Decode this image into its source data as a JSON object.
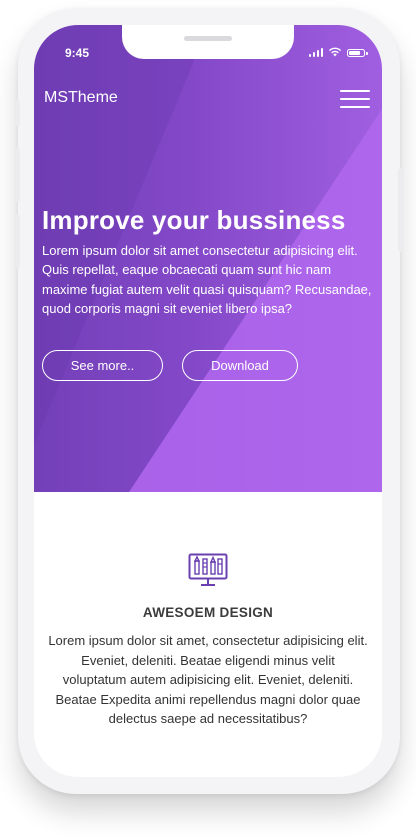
{
  "status_bar": {
    "time": "9:45"
  },
  "header": {
    "brand": "MSTheme",
    "menu_icon": "hamburger-menu-icon"
  },
  "hero": {
    "title": "Improve your bussiness",
    "text": "Lorem ipsum dolor sit amet consectetur adipisicing elit. Quis repellat, eaque obcaecati quam sunt hic nam maxime fugiat autem velit quasi quisquam? Recusandae, quod corporis magni sit eveniet libero ipsa?",
    "buttons": [
      {
        "label": "See more.."
      },
      {
        "label": "Download"
      }
    ]
  },
  "feature": {
    "icon": "design-monitor-icon",
    "title": "AWESOEM DESIGN",
    "text": "Lorem ipsum dolor sit amet, consectetur adipisicing elit. Eveniet, deleniti. Beatae eligendi minus velit voluptatum autem adipisicing elit. Eveniet, deleniti. Beatae Expedita animi repellendus magni dolor quae delectus saepe ad necessitatibus?"
  },
  "colors": {
    "hero_gradient_start": "#7340b8",
    "hero_gradient_end": "#a05fe0",
    "hero_highlight": "#b067ee",
    "hero_shadow": "#6637ad",
    "accent_icon": "#6a3fb0",
    "text_dark": "#333333"
  }
}
